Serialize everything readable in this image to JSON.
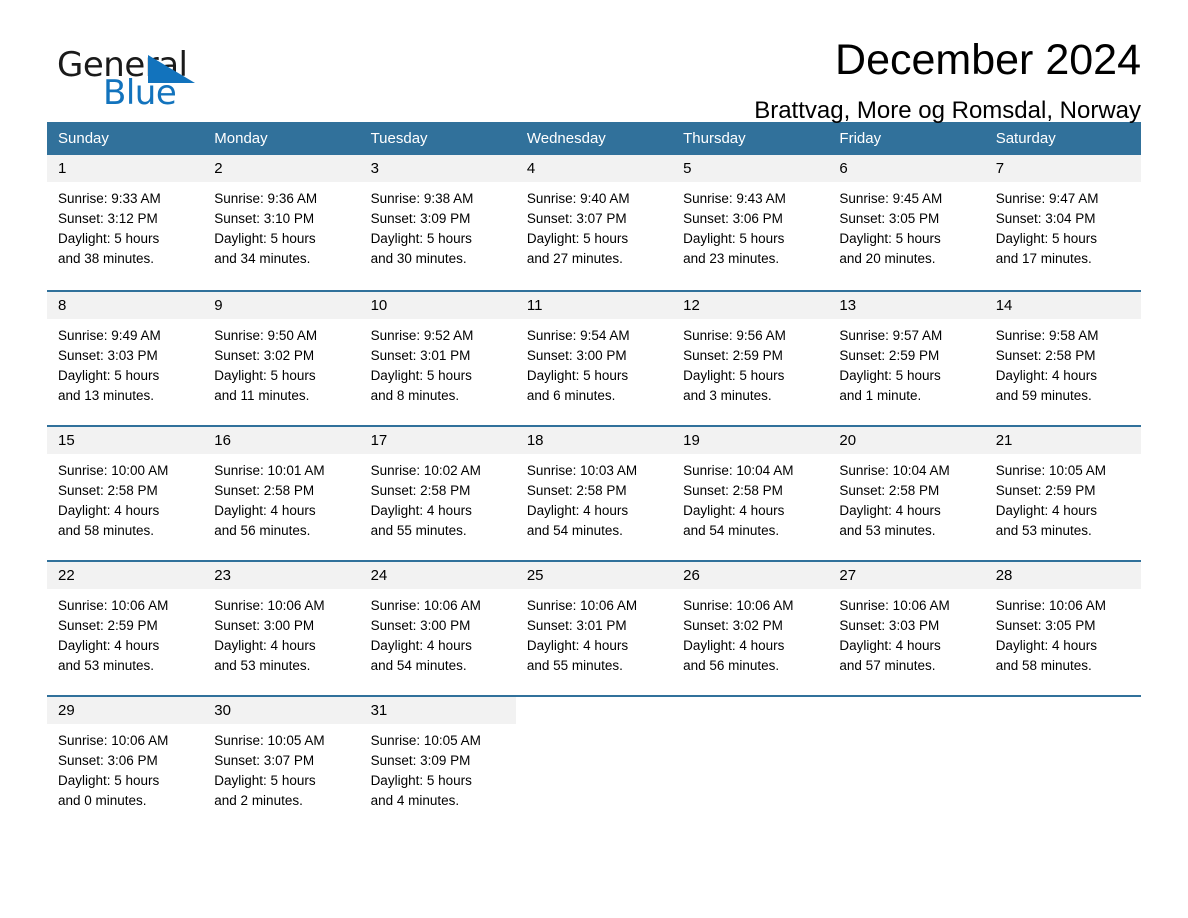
{
  "brand": {
    "name_part1": "General",
    "name_part2": "Blue",
    "accent_color": "#1273bd"
  },
  "header": {
    "title": "December 2024",
    "location": "Brattvag, More og Romsdal, Norway"
  },
  "calendar": {
    "header_color": "#31719b",
    "weekdays": [
      "Sunday",
      "Monday",
      "Tuesday",
      "Wednesday",
      "Thursday",
      "Friday",
      "Saturday"
    ],
    "weeks": [
      [
        {
          "day": "1",
          "sunrise": "Sunrise: 9:33 AM",
          "sunset": "Sunset: 3:12 PM",
          "daylight_line1": "Daylight: 5 hours",
          "daylight_line2": "and 38 minutes."
        },
        {
          "day": "2",
          "sunrise": "Sunrise: 9:36 AM",
          "sunset": "Sunset: 3:10 PM",
          "daylight_line1": "Daylight: 5 hours",
          "daylight_line2": "and 34 minutes."
        },
        {
          "day": "3",
          "sunrise": "Sunrise: 9:38 AM",
          "sunset": "Sunset: 3:09 PM",
          "daylight_line1": "Daylight: 5 hours",
          "daylight_line2": "and 30 minutes."
        },
        {
          "day": "4",
          "sunrise": "Sunrise: 9:40 AM",
          "sunset": "Sunset: 3:07 PM",
          "daylight_line1": "Daylight: 5 hours",
          "daylight_line2": "and 27 minutes."
        },
        {
          "day": "5",
          "sunrise": "Sunrise: 9:43 AM",
          "sunset": "Sunset: 3:06 PM",
          "daylight_line1": "Daylight: 5 hours",
          "daylight_line2": "and 23 minutes."
        },
        {
          "day": "6",
          "sunrise": "Sunrise: 9:45 AM",
          "sunset": "Sunset: 3:05 PM",
          "daylight_line1": "Daylight: 5 hours",
          "daylight_line2": "and 20 minutes."
        },
        {
          "day": "7",
          "sunrise": "Sunrise: 9:47 AM",
          "sunset": "Sunset: 3:04 PM",
          "daylight_line1": "Daylight: 5 hours",
          "daylight_line2": "and 17 minutes."
        }
      ],
      [
        {
          "day": "8",
          "sunrise": "Sunrise: 9:49 AM",
          "sunset": "Sunset: 3:03 PM",
          "daylight_line1": "Daylight: 5 hours",
          "daylight_line2": "and 13 minutes."
        },
        {
          "day": "9",
          "sunrise": "Sunrise: 9:50 AM",
          "sunset": "Sunset: 3:02 PM",
          "daylight_line1": "Daylight: 5 hours",
          "daylight_line2": "and 11 minutes."
        },
        {
          "day": "10",
          "sunrise": "Sunrise: 9:52 AM",
          "sunset": "Sunset: 3:01 PM",
          "daylight_line1": "Daylight: 5 hours",
          "daylight_line2": "and 8 minutes."
        },
        {
          "day": "11",
          "sunrise": "Sunrise: 9:54 AM",
          "sunset": "Sunset: 3:00 PM",
          "daylight_line1": "Daylight: 5 hours",
          "daylight_line2": "and 6 minutes."
        },
        {
          "day": "12",
          "sunrise": "Sunrise: 9:56 AM",
          "sunset": "Sunset: 2:59 PM",
          "daylight_line1": "Daylight: 5 hours",
          "daylight_line2": "and 3 minutes."
        },
        {
          "day": "13",
          "sunrise": "Sunrise: 9:57 AM",
          "sunset": "Sunset: 2:59 PM",
          "daylight_line1": "Daylight: 5 hours",
          "daylight_line2": "and 1 minute."
        },
        {
          "day": "14",
          "sunrise": "Sunrise: 9:58 AM",
          "sunset": "Sunset: 2:58 PM",
          "daylight_line1": "Daylight: 4 hours",
          "daylight_line2": "and 59 minutes."
        }
      ],
      [
        {
          "day": "15",
          "sunrise": "Sunrise: 10:00 AM",
          "sunset": "Sunset: 2:58 PM",
          "daylight_line1": "Daylight: 4 hours",
          "daylight_line2": "and 58 minutes."
        },
        {
          "day": "16",
          "sunrise": "Sunrise: 10:01 AM",
          "sunset": "Sunset: 2:58 PM",
          "daylight_line1": "Daylight: 4 hours",
          "daylight_line2": "and 56 minutes."
        },
        {
          "day": "17",
          "sunrise": "Sunrise: 10:02 AM",
          "sunset": "Sunset: 2:58 PM",
          "daylight_line1": "Daylight: 4 hours",
          "daylight_line2": "and 55 minutes."
        },
        {
          "day": "18",
          "sunrise": "Sunrise: 10:03 AM",
          "sunset": "Sunset: 2:58 PM",
          "daylight_line1": "Daylight: 4 hours",
          "daylight_line2": "and 54 minutes."
        },
        {
          "day": "19",
          "sunrise": "Sunrise: 10:04 AM",
          "sunset": "Sunset: 2:58 PM",
          "daylight_line1": "Daylight: 4 hours",
          "daylight_line2": "and 54 minutes."
        },
        {
          "day": "20",
          "sunrise": "Sunrise: 10:04 AM",
          "sunset": "Sunset: 2:58 PM",
          "daylight_line1": "Daylight: 4 hours",
          "daylight_line2": "and 53 minutes."
        },
        {
          "day": "21",
          "sunrise": "Sunrise: 10:05 AM",
          "sunset": "Sunset: 2:59 PM",
          "daylight_line1": "Daylight: 4 hours",
          "daylight_line2": "and 53 minutes."
        }
      ],
      [
        {
          "day": "22",
          "sunrise": "Sunrise: 10:06 AM",
          "sunset": "Sunset: 2:59 PM",
          "daylight_line1": "Daylight: 4 hours",
          "daylight_line2": "and 53 minutes."
        },
        {
          "day": "23",
          "sunrise": "Sunrise: 10:06 AM",
          "sunset": "Sunset: 3:00 PM",
          "daylight_line1": "Daylight: 4 hours",
          "daylight_line2": "and 53 minutes."
        },
        {
          "day": "24",
          "sunrise": "Sunrise: 10:06 AM",
          "sunset": "Sunset: 3:00 PM",
          "daylight_line1": "Daylight: 4 hours",
          "daylight_line2": "and 54 minutes."
        },
        {
          "day": "25",
          "sunrise": "Sunrise: 10:06 AM",
          "sunset": "Sunset: 3:01 PM",
          "daylight_line1": "Daylight: 4 hours",
          "daylight_line2": "and 55 minutes."
        },
        {
          "day": "26",
          "sunrise": "Sunrise: 10:06 AM",
          "sunset": "Sunset: 3:02 PM",
          "daylight_line1": "Daylight: 4 hours",
          "daylight_line2": "and 56 minutes."
        },
        {
          "day": "27",
          "sunrise": "Sunrise: 10:06 AM",
          "sunset": "Sunset: 3:03 PM",
          "daylight_line1": "Daylight: 4 hours",
          "daylight_line2": "and 57 minutes."
        },
        {
          "day": "28",
          "sunrise": "Sunrise: 10:06 AM",
          "sunset": "Sunset: 3:05 PM",
          "daylight_line1": "Daylight: 4 hours",
          "daylight_line2": "and 58 minutes."
        }
      ],
      [
        {
          "day": "29",
          "sunrise": "Sunrise: 10:06 AM",
          "sunset": "Sunset: 3:06 PM",
          "daylight_line1": "Daylight: 5 hours",
          "daylight_line2": "and 0 minutes."
        },
        {
          "day": "30",
          "sunrise": "Sunrise: 10:05 AM",
          "sunset": "Sunset: 3:07 PM",
          "daylight_line1": "Daylight: 5 hours",
          "daylight_line2": "and 2 minutes."
        },
        {
          "day": "31",
          "sunrise": "Sunrise: 10:05 AM",
          "sunset": "Sunset: 3:09 PM",
          "daylight_line1": "Daylight: 5 hours",
          "daylight_line2": "and 4 minutes."
        },
        {
          "day": "",
          "sunrise": "",
          "sunset": "",
          "daylight_line1": "",
          "daylight_line2": ""
        },
        {
          "day": "",
          "sunrise": "",
          "sunset": "",
          "daylight_line1": "",
          "daylight_line2": ""
        },
        {
          "day": "",
          "sunrise": "",
          "sunset": "",
          "daylight_line1": "",
          "daylight_line2": ""
        },
        {
          "day": "",
          "sunrise": "",
          "sunset": "",
          "daylight_line1": "",
          "daylight_line2": ""
        }
      ]
    ]
  }
}
